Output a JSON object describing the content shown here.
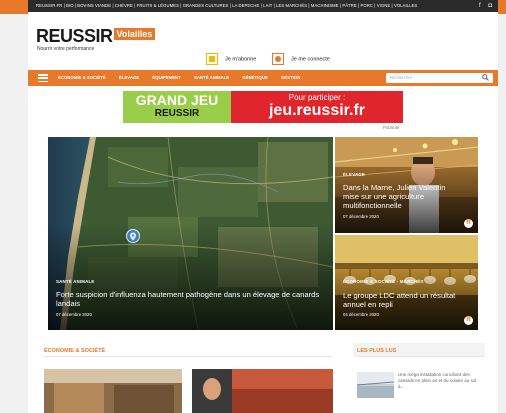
{
  "topbar": {
    "links": "REUSSIR.FR | BIO | BOVINS VIANDE | CHÈVRE | FRUITS & LÉGUMES | GRANDES CULTURES | LA DEPECHE | LAIT | LES MARCHÉS | MACHINISME | PÂTRE | PORC | VIGNE | VOLAILLES",
    "social": [
      "f",
      "◘"
    ]
  },
  "brand": {
    "name": "REUSSIR",
    "badge": "Volailles",
    "tagline": "Nourrir votre performance"
  },
  "account": {
    "subscribe": "Je m'abonne",
    "login": "Je me connecte"
  },
  "nav": {
    "items": [
      "ÉCONOMIE & SOCIÉTÉ",
      "ÉLEVAGE",
      "ÉQUIPEMENT",
      "SANTÉ ANIMALE",
      "GÉNÉTIQUE",
      "GESTION"
    ],
    "search_placeholder": "Rechercher"
  },
  "ad": {
    "left_line1": "GRAND JEU",
    "left_line2": "REUSSIR",
    "right_line1": "Pour participer :",
    "right_line2": "jeu.reussir.fr",
    "label": "Publicité"
  },
  "articles": {
    "main": {
      "category": "SANTÉ ANIMALE",
      "title": "Forte suspicion d'influenza hautement pathogène dans un élevage de canards landais",
      "date": "07 décembre 2020"
    },
    "side1": {
      "category": "ÉLEVAGE",
      "title": "Dans la Marne, Julien Valentin mise sur une agriculture multifonctionnelle",
      "date": "07 décembre 2020"
    },
    "side2": {
      "category": "ÉCONOMIE & SOCIÉTÉ - MARCHÉS",
      "title": "Le groupe LDC attend un résultat annuel en repli",
      "date": "04 décembre 2020"
    }
  },
  "sections": {
    "main_title": "ÉCONOMIE & SOCIÉTÉ",
    "aside_title": "LES PLUS LUS"
  },
  "most_read": {
    "text": "Une méga installation conciliant des canards en plein air et du solaire au sol à..."
  },
  "colors": {
    "accent": "#e8792a",
    "ad_green": "#9acd4a",
    "ad_red": "#e0262c"
  },
  "icons": {
    "menu": "hamburger-icon",
    "search": "search-icon",
    "map_pin": "map-pin-icon",
    "badge": "reussir-r-badge-icon"
  }
}
